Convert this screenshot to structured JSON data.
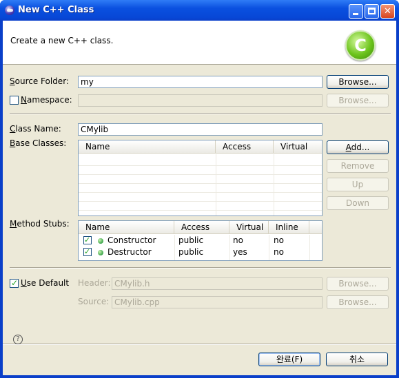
{
  "window": {
    "title": "New C++ Class"
  },
  "banner": {
    "description": "Create a new C++ class."
  },
  "source_folder": {
    "label_pre": "",
    "label_u": "S",
    "label_post": "ource Folder:",
    "value": "my",
    "browse": "Browse..."
  },
  "namespace": {
    "label_u": "N",
    "label_post": "amespace:",
    "value": "",
    "browse": "Browse..."
  },
  "class_name": {
    "label_u": "C",
    "label_post": "lass Name:",
    "value": "CMylib"
  },
  "base_classes": {
    "label_u": "B",
    "label_post": "ase Classes:",
    "columns": [
      "Name",
      "Access",
      "Virtual"
    ],
    "add": "Add...",
    "remove": "Remove",
    "up": "Up",
    "down": "Down"
  },
  "method_stubs": {
    "label_u": "M",
    "label_post": "ethod Stubs:",
    "columns": [
      "Name",
      "Access",
      "Virtual",
      "Inline"
    ],
    "rows": [
      {
        "checked": true,
        "name": "Constructor",
        "access": "public",
        "virtual": "no",
        "inline": "no"
      },
      {
        "checked": true,
        "name": "Destructor",
        "access": "public",
        "virtual": "yes",
        "inline": "no"
      }
    ]
  },
  "use_default": {
    "checked": true,
    "label_u": "U",
    "label_post": "se Default"
  },
  "header": {
    "label_pre": "Header:",
    "value": "CMylib.h",
    "browse": "Browse..."
  },
  "source": {
    "label_pre": "Source:",
    "value": "CMylib.cpp",
    "browse": "Browse..."
  },
  "footer": {
    "finish": "완료(F)",
    "cancel": "취소"
  },
  "icons": {
    "help": "?",
    "check": "✓",
    "close": "✕"
  }
}
